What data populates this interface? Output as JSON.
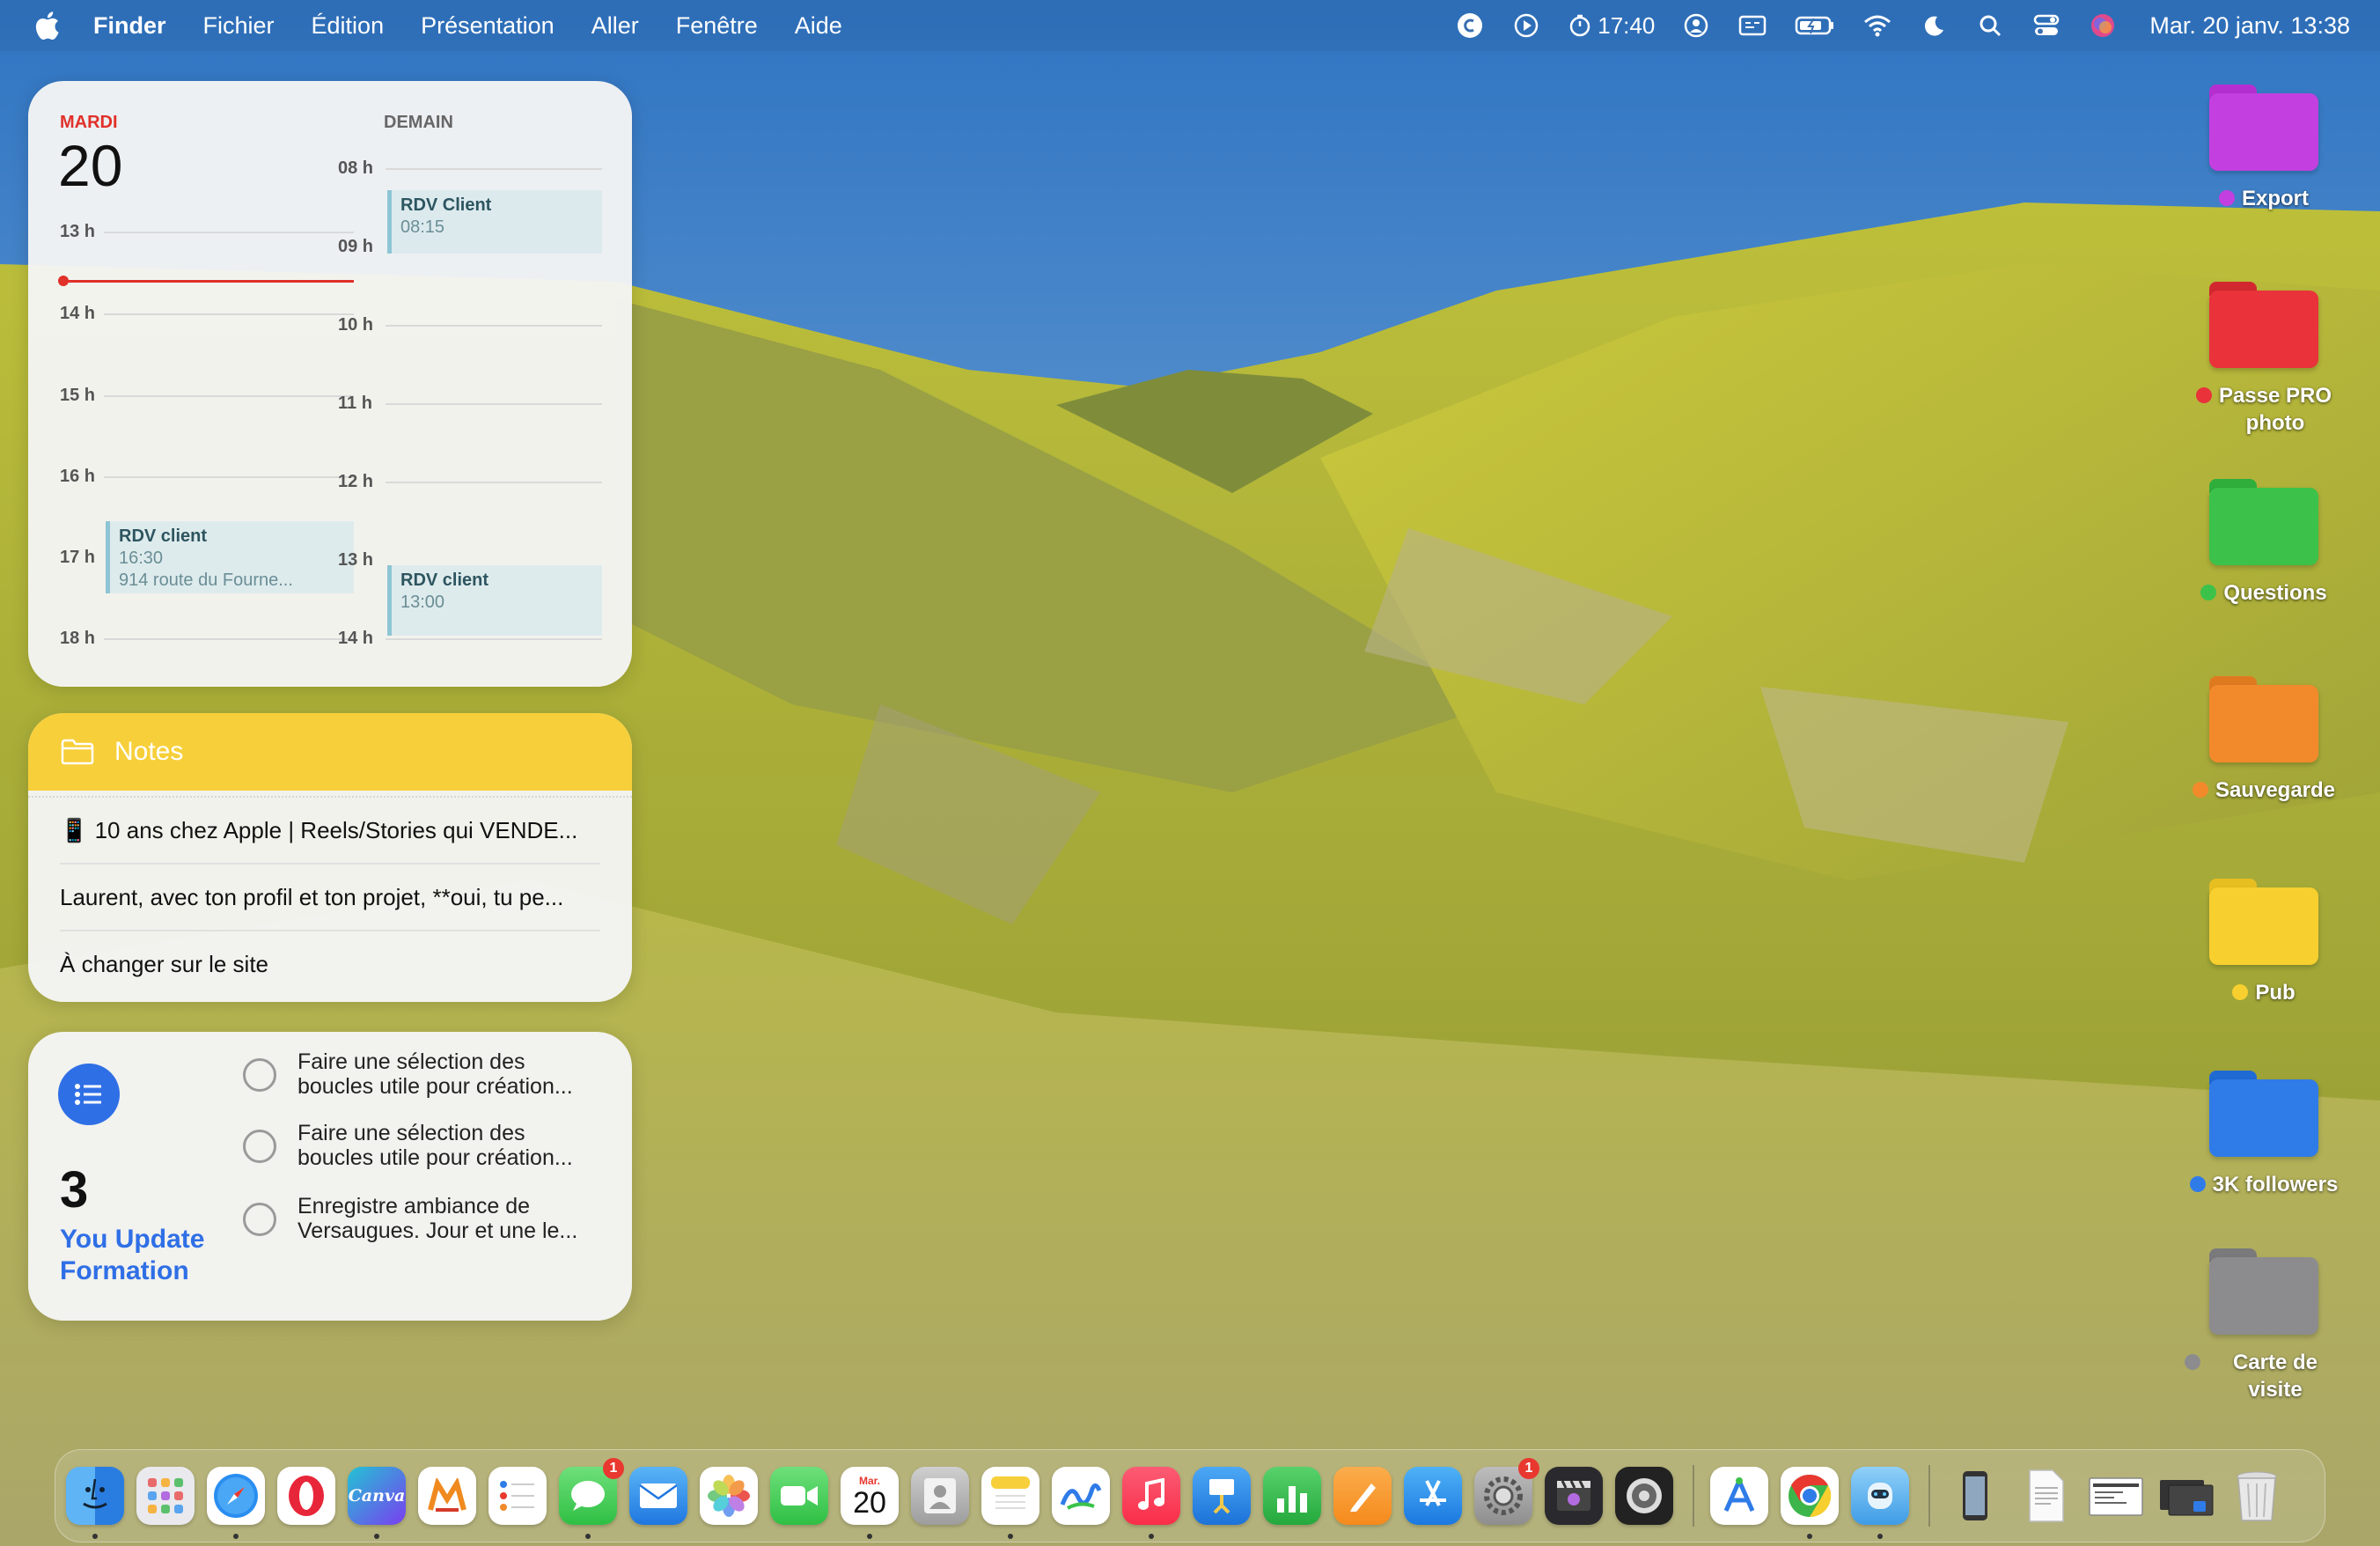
{
  "menubar": {
    "app_name": "Finder",
    "menus": [
      "Fichier",
      "Édition",
      "Présentation",
      "Aller",
      "Fenêtre",
      "Aide"
    ],
    "timer": "17:40",
    "clock": "Mar. 20 janv.  13:38",
    "status_icons": [
      "c-icon",
      "play-icon",
      "timer-icon",
      "account-icon",
      "caption-icon",
      "battery-icon",
      "wifi-icon",
      "moon-icon",
      "search-icon",
      "control-center-icon",
      "siri-icon"
    ]
  },
  "calendar": {
    "today_label": "MARDI",
    "today_number": "20",
    "tomorrow_label": "DEMAIN",
    "today_hours": [
      "13 h",
      "14 h",
      "15 h",
      "16 h",
      "17 h",
      "18 h"
    ],
    "tomorrow_hours": [
      "08 h",
      "09 h",
      "10 h",
      "11 h",
      "12 h",
      "13 h",
      "14 h"
    ],
    "events": [
      {
        "title": "RDV Client",
        "time": "08:15",
        "location": ""
      },
      {
        "title": "RDV client",
        "time": "16:30",
        "location": "914 route du Fourne..."
      },
      {
        "title": "RDV client",
        "time": "13:00",
        "location": ""
      }
    ]
  },
  "notes": {
    "title": "Notes",
    "items": [
      "📱 10 ans chez Apple | Reels/Stories qui VENDE...",
      "Laurent, avec ton profil et ton projet, **oui, tu pe...",
      "À changer sur le site"
    ]
  },
  "reminders": {
    "count": "3",
    "list_name_line1": "You Update",
    "list_name_line2": "Formation",
    "items": [
      {
        "line1": "Faire une sélection des",
        "line2": "boucles utile pour création..."
      },
      {
        "line1": "Faire une sélection des",
        "line2": "boucles utile pour création..."
      },
      {
        "line1": "Enregistre ambiance de",
        "line2": "Versaugues. Jour et une le..."
      }
    ]
  },
  "desktop_folders": [
    {
      "label": "Export",
      "color": "#c33fe0",
      "tag": "#c33fe0"
    },
    {
      "label": "Passe PRO photo",
      "line1": "Passe PRO",
      "line2": "photo",
      "color": "#e9323a",
      "tag": "#e9323a"
    },
    {
      "label": "Questions",
      "color": "#3cc24a",
      "tag": "#3cc24a"
    },
    {
      "label": "Sauvegarde",
      "color": "#f28a2c",
      "tag": "#f28a2c"
    },
    {
      "label": "Pub",
      "color": "#f7cf2e",
      "tag": "#f7cf2e"
    },
    {
      "label": "3K followers",
      "color": "#2f7be8",
      "tag": "#2f7be8"
    },
    {
      "label": "Carte de visite",
      "color": "#8c8c8e",
      "tag": "#8c8c8e"
    }
  ],
  "dock": {
    "calendar_month": "Mar.",
    "calendar_day": "20",
    "messages_badge": "1",
    "settings_badge": "1",
    "canva_label": "Canva",
    "apps": [
      "finder-icon",
      "launchpad-icon",
      "safari-icon",
      "opera-icon",
      "canva-icon",
      "mirror-icon",
      "reminders-icon",
      "messages-icon",
      "mail-icon",
      "photos-icon",
      "facetime-icon",
      "calendar-icon",
      "contacts-icon",
      "notes-icon",
      "freeform-icon",
      "music-icon",
      "keynote-icon",
      "numbers-icon",
      "pages-icon",
      "appstore-icon",
      "settings-icon",
      "imovie-icon",
      "compressor-icon",
      "altstore-icon",
      "chrome-icon",
      "bot-icon",
      "recent-file-icon",
      "pdf-doc-icon",
      "screenshot-icon",
      "window-stack-icon",
      "trash-icon"
    ]
  }
}
